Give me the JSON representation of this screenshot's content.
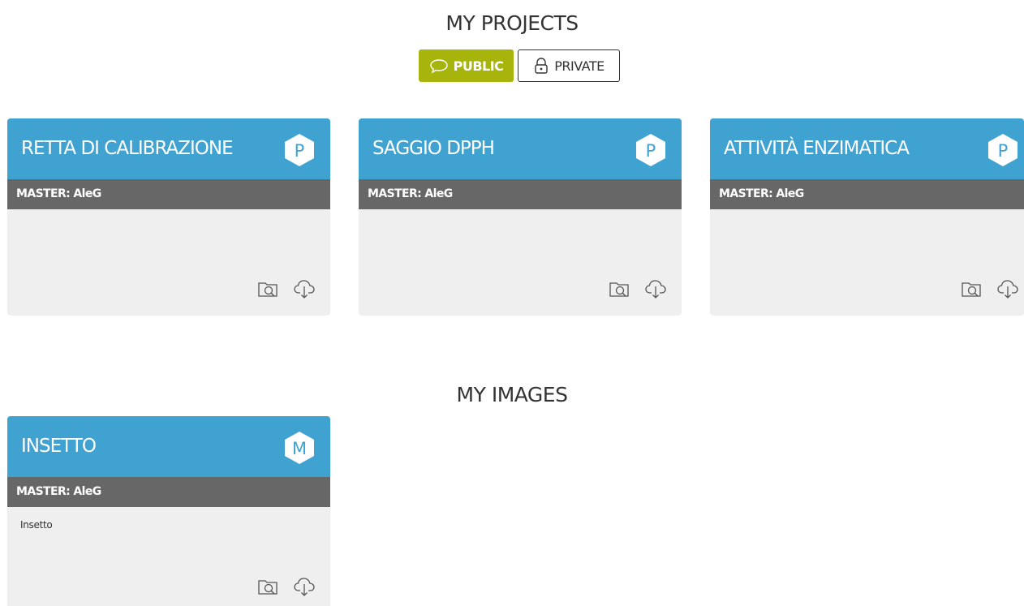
{
  "projects": {
    "title": "MY PROJECTS",
    "toggle": {
      "public_label": "PUBLIC",
      "private_label": "PRIVATE",
      "active": "public"
    },
    "cards": [
      {
        "title": "RETTA DI CALIBRAZIONE",
        "badge": "P",
        "master": "MASTER: AleG",
        "description": ""
      },
      {
        "title": "SAGGIO DPPH",
        "badge": "P",
        "master": "MASTER: AleG",
        "description": ""
      },
      {
        "title": "ATTIVITÀ ENZIMATICA",
        "badge": "P",
        "master": "MASTER: AleG",
        "description": ""
      }
    ]
  },
  "images": {
    "title": "MY IMAGES",
    "cards": [
      {
        "title": "INSETTO",
        "badge": "M",
        "master": "MASTER: AleG",
        "description": "Insetto"
      }
    ]
  },
  "icons": {
    "browse": "folder-search-icon",
    "download": "cloud-download-icon",
    "public": "speech-bubble-icon",
    "private": "padlock-icon"
  },
  "colors": {
    "header": "#3fa2d1",
    "master_bar": "#676767",
    "card_body": "#efefef",
    "public_active": "#a6b40b"
  }
}
